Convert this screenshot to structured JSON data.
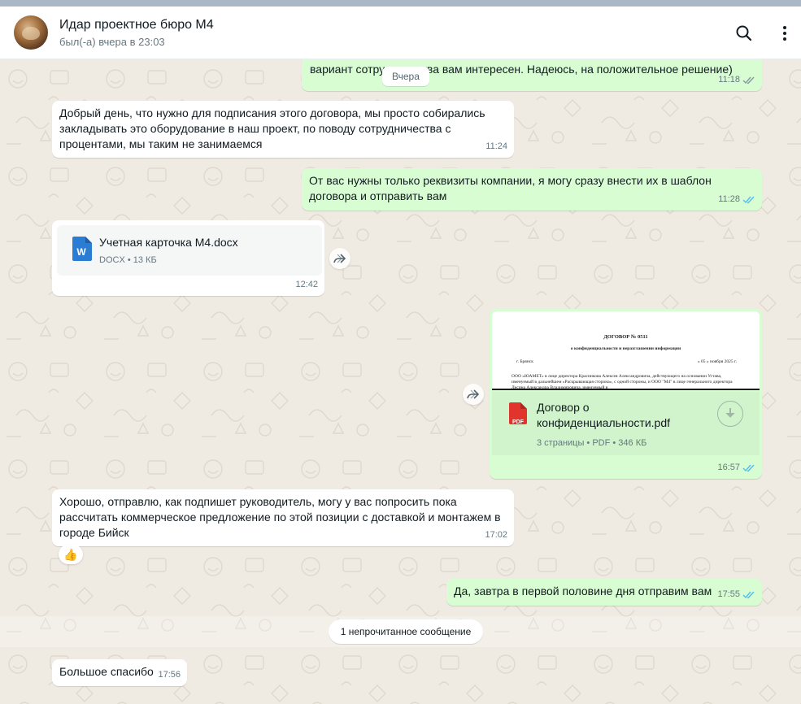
{
  "header": {
    "contact_name": "Идар проектное бюро М4",
    "status": "был(-а) вчера в 23:03",
    "search_icon": "search-icon",
    "menu_icon": "more-vertical-icon"
  },
  "colors": {
    "incoming_bubble": "#ffffff",
    "outgoing_bubble": "#d9fdd3",
    "read_ticks": "#53bdeb",
    "delivered_ticks": "#8696a0",
    "pdf_red": "#e0342c",
    "word_blue": "#2b7cd3"
  },
  "messages": [
    {
      "direction": "out",
      "text": "вариант сотрудничества вам интересен. Надеюсь, на положительное решение)",
      "time": "11:18",
      "status": "delivered"
    },
    {
      "type": "date_separator",
      "text": "Вчера"
    },
    {
      "direction": "in",
      "text": "Добрый день, что нужно для подписания этого договора, мы просто собирались закладывать это оборудование в наш проект, по поводу сотрудничества с процентами, мы таким не занимаемся",
      "time": "11:24"
    },
    {
      "direction": "out",
      "text": "От вас нужны только реквизиты компании, я могу сразу внести их в шаблон договора и отправить вам",
      "time": "11:28",
      "status": "read"
    },
    {
      "direction": "in",
      "type": "document",
      "file_name": "Учетная карточка М4.docx",
      "file_meta": "DOCX • 13 КБ",
      "file_icon": "word-doc-icon",
      "time": "12:42"
    },
    {
      "direction": "out",
      "type": "pdf",
      "preview": {
        "title": "ДОГОВОР № 0511",
        "subtitle": "о конфиденциальности и неразглашении информации",
        "city": "г. Брянск",
        "date": "« 05 » ноября 2025 г.",
        "body": "ООО «ЮАМЕТ» в лице директора Красникова Алексея Александровича, действующего на основании Устава, именуемый в дальнейшем «Раскрывающая сторона», с одной стороны, и ООО \"М4\" в лице генерального директора Лесина Александра Владимировича, именуемый в"
      },
      "file_name": "Договор о конфиденциальности.pdf",
      "file_meta": "3 страницы • PDF • 346 КБ",
      "file_icon": "pdf-icon",
      "pdf_badge": "PDF",
      "time": "16:57",
      "status": "read"
    },
    {
      "direction": "in",
      "text": "Хорошо, отправлю, как подпишет руководитель, могу у вас попросить пока рассчитать коммерческое предложение по этой позиции с доставкой и монтажем в городе Бийск",
      "time": "17:02",
      "reaction": "👍"
    },
    {
      "direction": "out",
      "text": "Да, завтра в первой половине дня отправим вам",
      "time": "17:55",
      "status": "read"
    },
    {
      "type": "unread_separator",
      "text": "1 непрочитанное сообщение"
    },
    {
      "direction": "in",
      "text": "Большое спасибо",
      "time": "17:56"
    }
  ]
}
